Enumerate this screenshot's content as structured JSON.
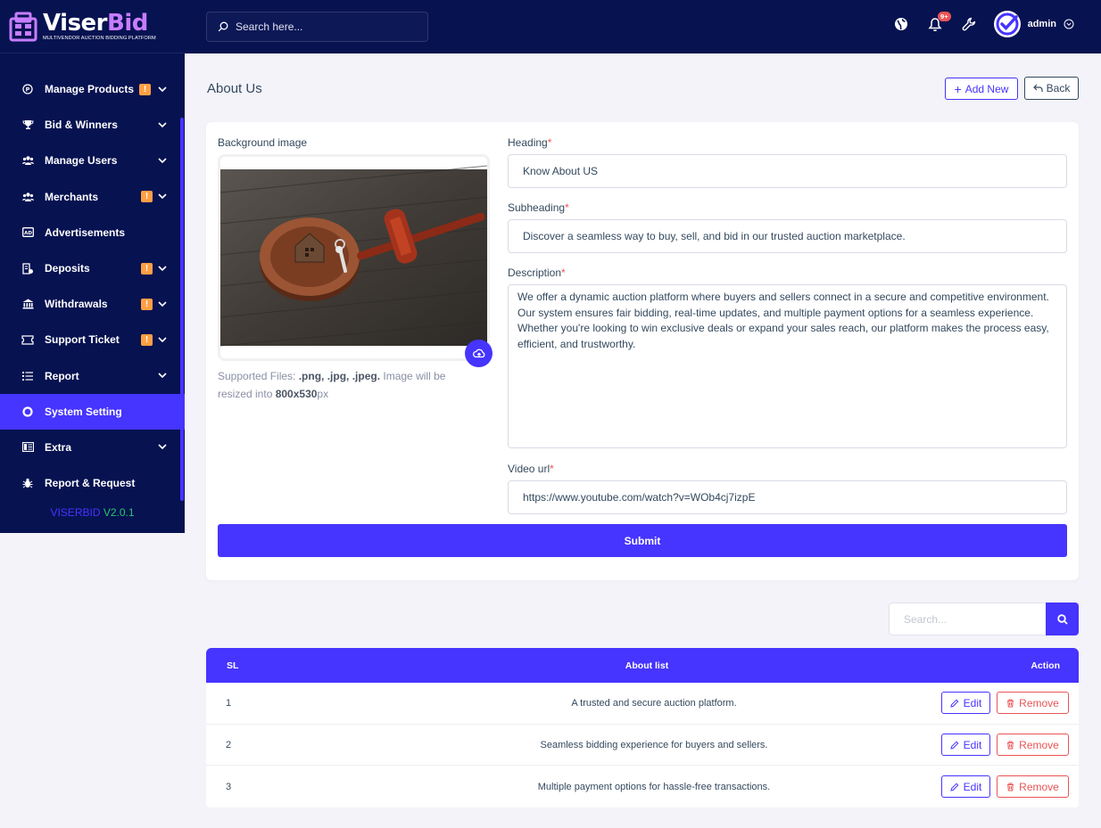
{
  "brand": {
    "name_part1": "Viser",
    "name_part2": "Bid",
    "tagline": "MULTIVENDOR AUCTION BIDDING PLATFORM",
    "version_label": "VISERBID",
    "version_number": "V2.0.1"
  },
  "topbar": {
    "search_placeholder": "Search here...",
    "notification_count": "9+",
    "username": "admin"
  },
  "sidebar": {
    "items": [
      {
        "label": "Manage Products",
        "icon": "product-icon",
        "warning": true,
        "chevron": true,
        "active": false
      },
      {
        "label": "Bid & Winners",
        "icon": "trophy-icon",
        "warning": false,
        "chevron": true,
        "active": false
      },
      {
        "label": "Manage Users",
        "icon": "users-icon",
        "warning": false,
        "chevron": true,
        "active": false
      },
      {
        "label": "Merchants",
        "icon": "merchants-icon",
        "warning": true,
        "chevron": true,
        "active": false
      },
      {
        "label": "Advertisements",
        "icon": "ad-icon",
        "warning": false,
        "chevron": false,
        "active": false
      },
      {
        "label": "Deposits",
        "icon": "deposit-icon",
        "warning": true,
        "chevron": true,
        "active": false
      },
      {
        "label": "Withdrawals",
        "icon": "bank-icon",
        "warning": true,
        "chevron": true,
        "active": false
      },
      {
        "label": "Support Ticket",
        "icon": "ticket-icon",
        "warning": true,
        "chevron": true,
        "active": false
      },
      {
        "label": "Report",
        "icon": "list-icon",
        "warning": false,
        "chevron": true,
        "active": false
      },
      {
        "label": "System Setting",
        "icon": "life-ring-icon",
        "warning": false,
        "chevron": false,
        "active": true
      },
      {
        "label": "Extra",
        "icon": "server-icon",
        "warning": false,
        "chevron": true,
        "active": false
      },
      {
        "label": "Report & Request",
        "icon": "bug-icon",
        "warning": false,
        "chevron": false,
        "active": false
      }
    ],
    "warning_symbol": "!"
  },
  "page": {
    "title": "About Us",
    "add_new_label": "Add New",
    "back_label": "Back"
  },
  "form": {
    "bg_image_label": "Background image",
    "support_prefix": "Supported Files: ",
    "support_types": ".png, .jpg, .jpeg.",
    "support_mid": " Image will be resized into ",
    "support_size": "800x530",
    "support_suffix": "px",
    "heading_label": "Heading",
    "heading_value": "Know About US",
    "subheading_label": "Subheading",
    "subheading_value": "Discover a seamless way to buy, sell, and bid in our trusted auction marketplace.",
    "description_label": "Description",
    "description_value": "We offer a dynamic auction platform where buyers and sellers connect in a secure and competitive environment. Our system ensures fair bidding, real-time updates, and multiple payment options for a seamless experience. Whether you're looking to win exclusive deals or expand your sales reach, our platform makes the process easy, efficient, and trustworthy.",
    "video_label": "Video url",
    "video_value": "https://www.youtube.com/watch?v=WOb4cj7izpE",
    "required_mark": "*",
    "submit_label": "Submit"
  },
  "list": {
    "search_placeholder": "Search...",
    "columns": {
      "sl": "SL",
      "about": "About list",
      "action": "Action"
    },
    "edit_label": "Edit",
    "remove_label": "Remove",
    "rows": [
      {
        "sl": "1",
        "text": "A trusted and secure auction platform."
      },
      {
        "sl": "2",
        "text": "Seamless bidding experience for buyers and sellers."
      },
      {
        "sl": "3",
        "text": "Multiple payment options for hassle-free transactions."
      }
    ]
  },
  "colors": {
    "primary": "#4634ff",
    "sidebar_bg": "#071251",
    "warning": "#ff9f43",
    "danger": "#ea5455",
    "success": "#28c76f"
  }
}
